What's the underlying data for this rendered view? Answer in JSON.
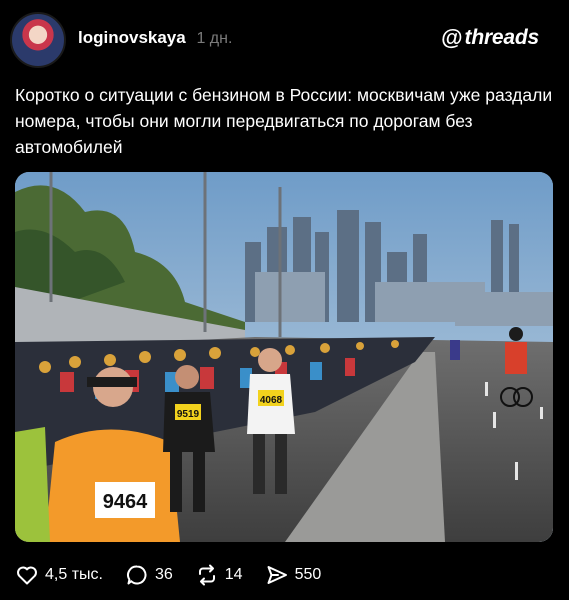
{
  "post": {
    "username": "loginovskaya",
    "time": "1 дн.",
    "brand": "threads",
    "brand_icon": "@",
    "text": "Коротко о ситуации с бензином в России: москвичам уже раздали номера, чтобы они могли передвигаться по дорогам без автомобилей"
  },
  "photo": {
    "bibs": [
      "9464",
      "9519",
      "4068"
    ]
  },
  "actions": {
    "likes": "4,5 тыс.",
    "comments": "36",
    "reposts": "14",
    "shares": "550"
  }
}
